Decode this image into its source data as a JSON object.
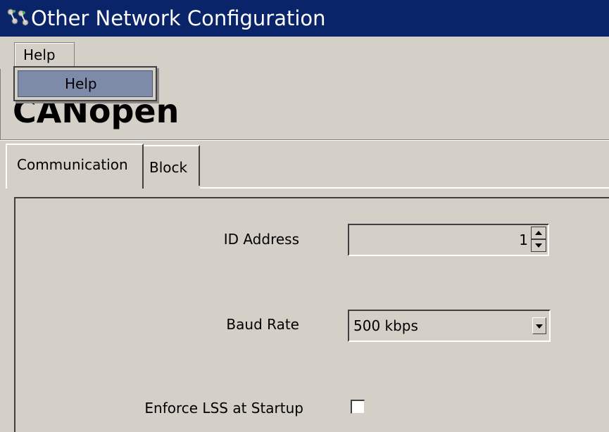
{
  "window": {
    "title": "Other Network Configuration",
    "icon": "network-icon"
  },
  "menu": {
    "help_label": "Help",
    "dropdown": {
      "open": true,
      "items": [
        {
          "label": "Help",
          "highlighted": true
        }
      ]
    }
  },
  "page": {
    "heading": "CANopen"
  },
  "tabs": [
    {
      "label": "Communication",
      "selected": true
    },
    {
      "label": "Block",
      "selected": false
    }
  ],
  "form": {
    "id_address": {
      "label": "ID Address",
      "value": "1"
    },
    "baud_rate": {
      "label": "Baud Rate",
      "value": "500 kbps"
    },
    "enforce_lss": {
      "label": "Enforce LSS at Startup",
      "checked": false
    }
  },
  "colors": {
    "titlebar": "#0a246a",
    "face": "#d4d0c8",
    "highlight": "#7d8aa8"
  }
}
